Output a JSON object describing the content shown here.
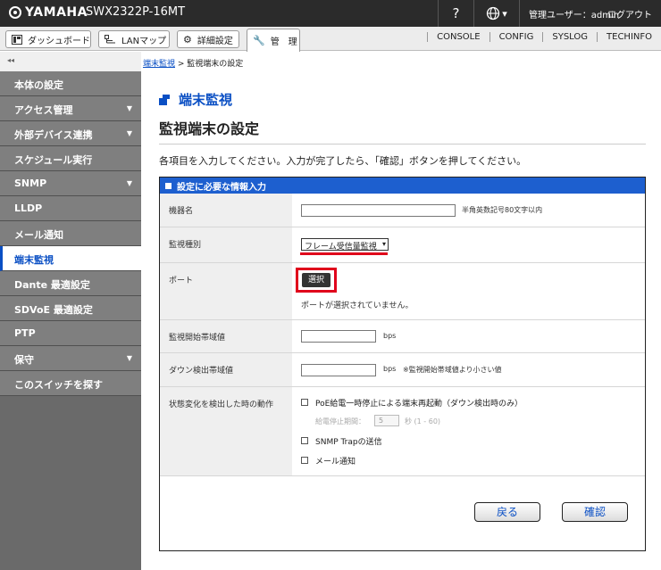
{
  "header": {
    "brand": "YAMAHA",
    "model": "SWX2322P-16MT",
    "help_label": "?",
    "lang_arrow": "▾",
    "user": "管理ユーザー：admin",
    "logout": "ログアウト"
  },
  "tabs": [
    {
      "label": "ダッシュボード",
      "icon": "dashboard-icon"
    },
    {
      "label": "LANマップ",
      "icon": "lan-map-icon"
    },
    {
      "label": "詳細設定",
      "icon": "gear-icon"
    },
    {
      "label": "管　理",
      "icon": "wrench-icon",
      "active": true
    }
  ],
  "right_links": [
    "CONSOLE",
    "CONFIG",
    "SYSLOG",
    "TECHINFO"
  ],
  "sidebar": {
    "collapse": "◂◂",
    "items": [
      {
        "label": "本体の設定",
        "chevron": ""
      },
      {
        "label": "アクセス管理",
        "chevron": "▼"
      },
      {
        "label": "外部デバイス連携",
        "chevron": "▼"
      },
      {
        "label": "スケジュール実行",
        "chevron": ""
      },
      {
        "label": "SNMP",
        "chevron": "▼"
      },
      {
        "label": "LLDP",
        "chevron": ""
      },
      {
        "label": "メール通知",
        "chevron": ""
      },
      {
        "label": "端末監視",
        "chevron": "",
        "active": true
      },
      {
        "label": "Dante 最適設定",
        "chevron": ""
      },
      {
        "label": "SDVoE 最適設定",
        "chevron": ""
      },
      {
        "label": "PTP",
        "chevron": ""
      },
      {
        "label": "保守",
        "chevron": "▼"
      },
      {
        "label": "このスイッチを探す",
        "chevron": ""
      }
    ]
  },
  "breadcrumb": {
    "link": "端末監視",
    "separator": " > ",
    "current": "監視端末の設定"
  },
  "section_title": "端末監視",
  "page_title": "監視端末の設定",
  "instruction": "各項目を入力してください。入力が完了したら、「確認」ボタンを押してください。",
  "panel": {
    "header": "設定に必要な情報入力",
    "device_name": {
      "label": "機器名",
      "value": "",
      "hint": "半角英数記号80文字以内"
    },
    "monitor_type": {
      "label": "監視種別",
      "selected": "フレーム受信量監視",
      "arrow": "▾"
    },
    "port": {
      "label": "ポート",
      "button": "選択",
      "status": "ポートが選択されていません。"
    },
    "start_threshold": {
      "label": "監視開始帯域値",
      "value": "",
      "unit": "bps"
    },
    "down_threshold": {
      "label": "ダウン検出帯域値",
      "value": "",
      "unit": "bps",
      "hint": "※監視開始帯域値より小さい値"
    },
    "action": {
      "label": "状態変化を検出した時の動作",
      "poe_restart": "PoE給電一時停止による端末再起動（ダウン検出時のみ）",
      "pause_label": "給電停止期間：",
      "pause_value": "5",
      "pause_unit": "秒 (1 - 60)",
      "snmp_trap": "SNMP Trapの送信",
      "mail": "メール通知"
    }
  },
  "buttons": {
    "back": "戻る",
    "confirm": "確認"
  }
}
